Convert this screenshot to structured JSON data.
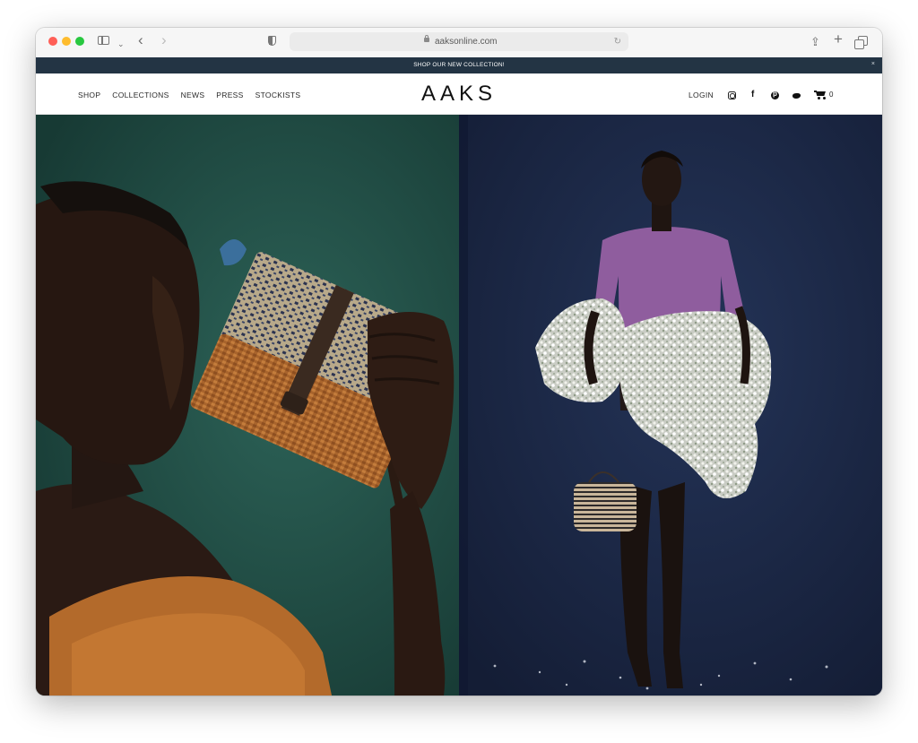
{
  "browser": {
    "url": "aaksonline.com",
    "icons": [
      "sidebar-icon",
      "chevron-down-icon",
      "back-arrow-icon",
      "forward-arrow-icon",
      "privacy-shield-icon",
      "lock-icon",
      "reload-icon",
      "share-icon",
      "new-tab-icon",
      "tabs-overview-icon"
    ]
  },
  "announcement": {
    "text": "SHOP OUR NEW COLLECTION!",
    "close": "×"
  },
  "header": {
    "nav": [
      "SHOP",
      "COLLECTIONS",
      "NEWS",
      "PRESS",
      "STOCKISTS"
    ],
    "logo": "AAKS",
    "login": "LOGIN",
    "social_icons": [
      "instagram-icon",
      "facebook-icon",
      "pinterest-icon",
      "twitter-icon"
    ],
    "cart_count": "0"
  },
  "hero": {
    "panels": [
      "model-with-woven-clutch",
      "model-with-flowers-and-basket"
    ]
  },
  "colors": {
    "announcement_bg": "#233444",
    "left_panel_bg": "#24534b",
    "right_panel_bg": "#1d2a48"
  }
}
